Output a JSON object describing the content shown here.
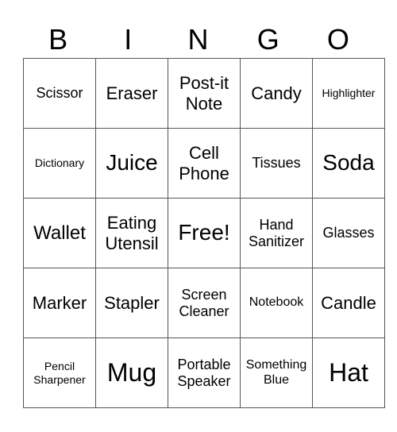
{
  "title_letters": [
    "B",
    "I",
    "N",
    "G",
    "O"
  ],
  "rows": [
    [
      "Scissor",
      "Eraser",
      "Post-it Note",
      "Candy",
      "Highlighter"
    ],
    [
      "Dictionary",
      "Juice",
      "Cell Phone",
      "Tissues",
      "Soda"
    ],
    [
      "Wallet",
      "Eating Utensil",
      "Free!",
      "Hand Sanitizer",
      "Glasses"
    ],
    [
      "Marker",
      "Stapler",
      "Screen Cleaner",
      "Notebook",
      "Candle"
    ],
    [
      "Pencil Sharpener",
      "Mug",
      "Portable Speaker",
      "Something Blue",
      "Hat"
    ]
  ]
}
